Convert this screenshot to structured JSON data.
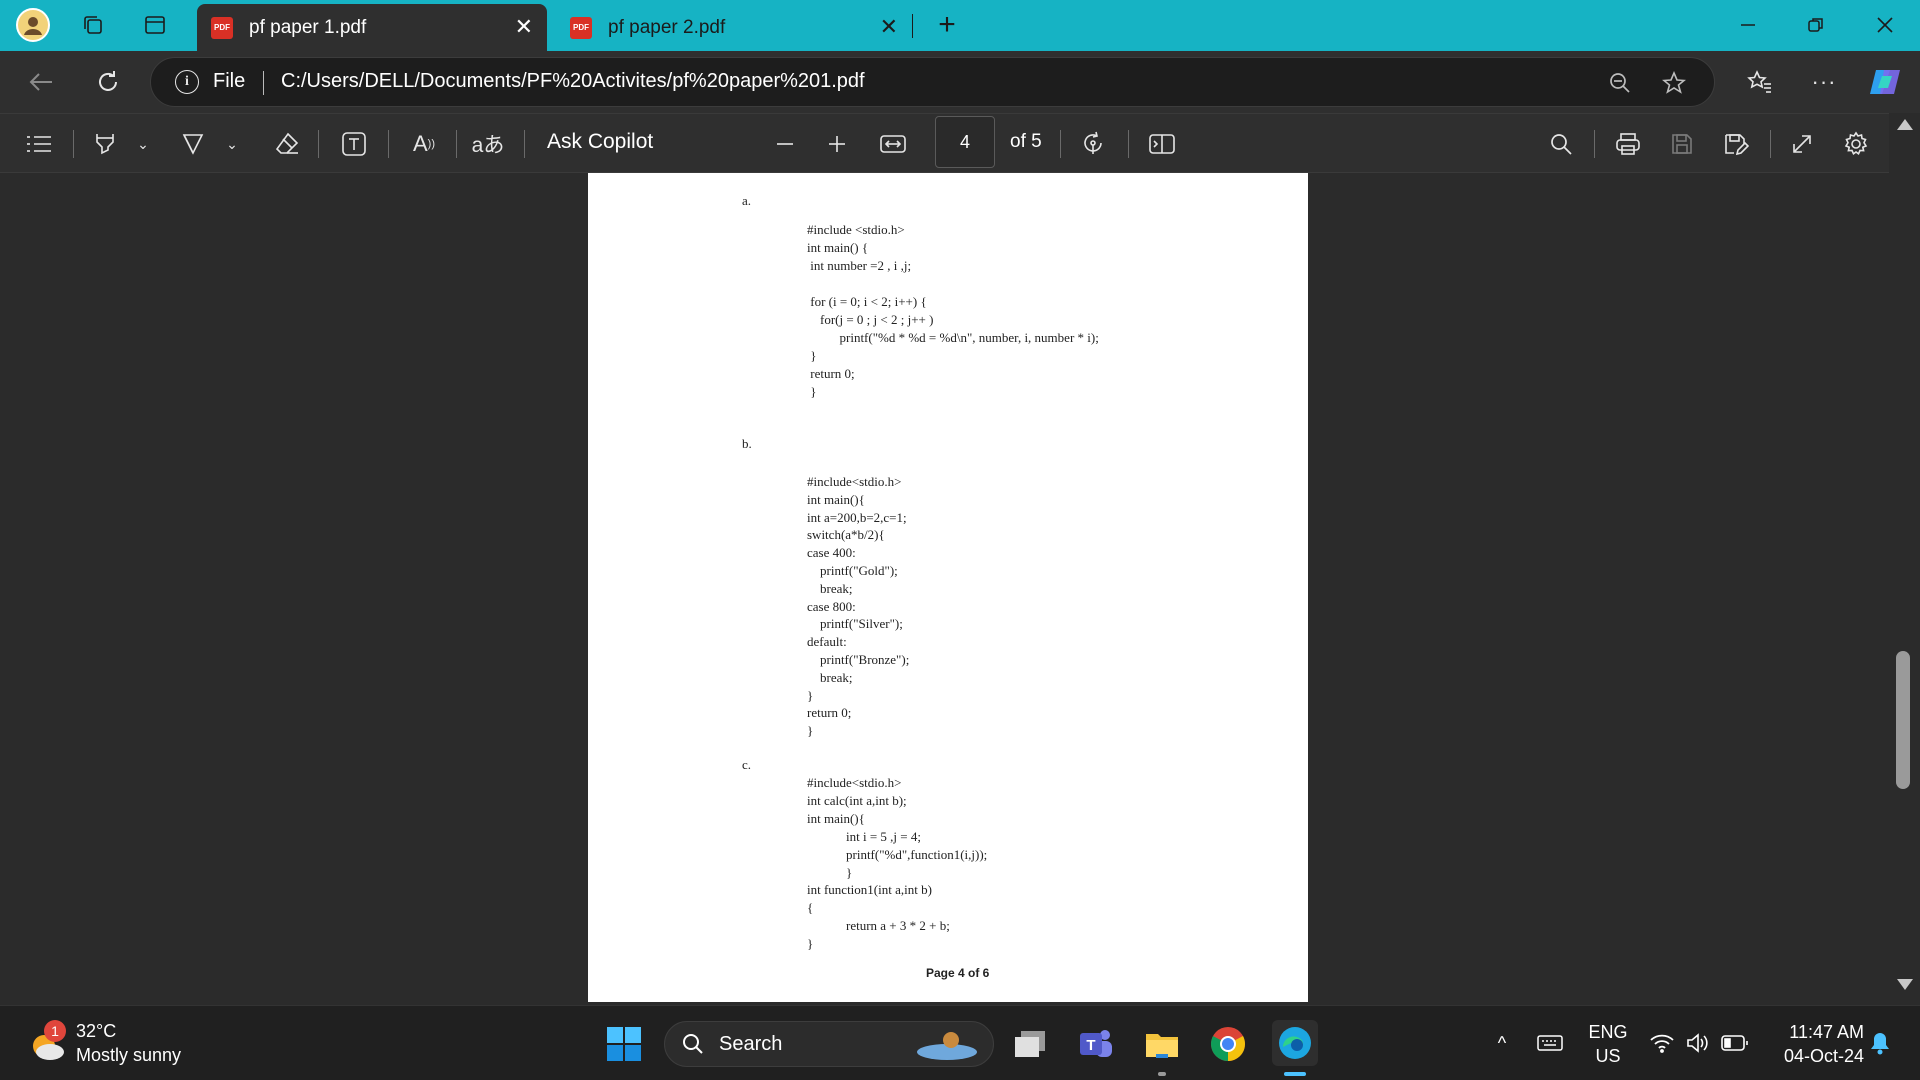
{
  "tabs": [
    {
      "label": "pf paper 1.pdf",
      "active": true
    },
    {
      "label": "pf paper 2.pdf",
      "active": false
    }
  ],
  "address": {
    "scheme_label": "File",
    "url": "C:/Users/DELL/Documents/PF%20Activites/pf%20paper%201.pdf"
  },
  "toolbar": {
    "ask_copilot": "Ask Copilot",
    "page_current": "4",
    "page_total": "of 5"
  },
  "document": {
    "label_a": "a.",
    "code_a": "#include <stdio.h>\nint main() {\n int number =2 , i ,j;\n\n for (i = 0; i < 2; i++) {\n    for(j = 0 ; j < 2 ; j++ )\n          printf(\"%d * %d = %d\\n\", number, i, number * i);\n }\n return 0;\n }",
    "label_b": "b.",
    "code_b": "#include<stdio.h>\nint main(){\nint a=200,b=2,c=1;\nswitch(a*b/2){\ncase 400:\n    printf(\"Gold\");\n    break;\ncase 800:\n    printf(\"Silver\");\ndefault:\n    printf(\"Bronze\");\n    break;\n}\nreturn 0;\n}",
    "label_c": "c.",
    "code_c": "#include<stdio.h>\nint calc(int a,int b);\nint main(){\n            int i = 5 ,j = 4;\n            printf(\"%d\",function1(i,j));\n            }\nint function1(int a,int b)\n{\n            return a + 3 * 2 + b;\n}",
    "footer": "Page 4 of 6"
  },
  "taskbar": {
    "weather_temp": "32°C",
    "weather_desc": "Mostly sunny",
    "weather_badge": "1",
    "search_label": "Search",
    "lang_top": "ENG",
    "lang_bottom": "US",
    "time": "11:47 AM",
    "date": "04-Oct-24"
  },
  "colors": {
    "tabstrip": "#16b3c4",
    "chrome": "#2f2f2f",
    "taskbar": "#202020"
  }
}
